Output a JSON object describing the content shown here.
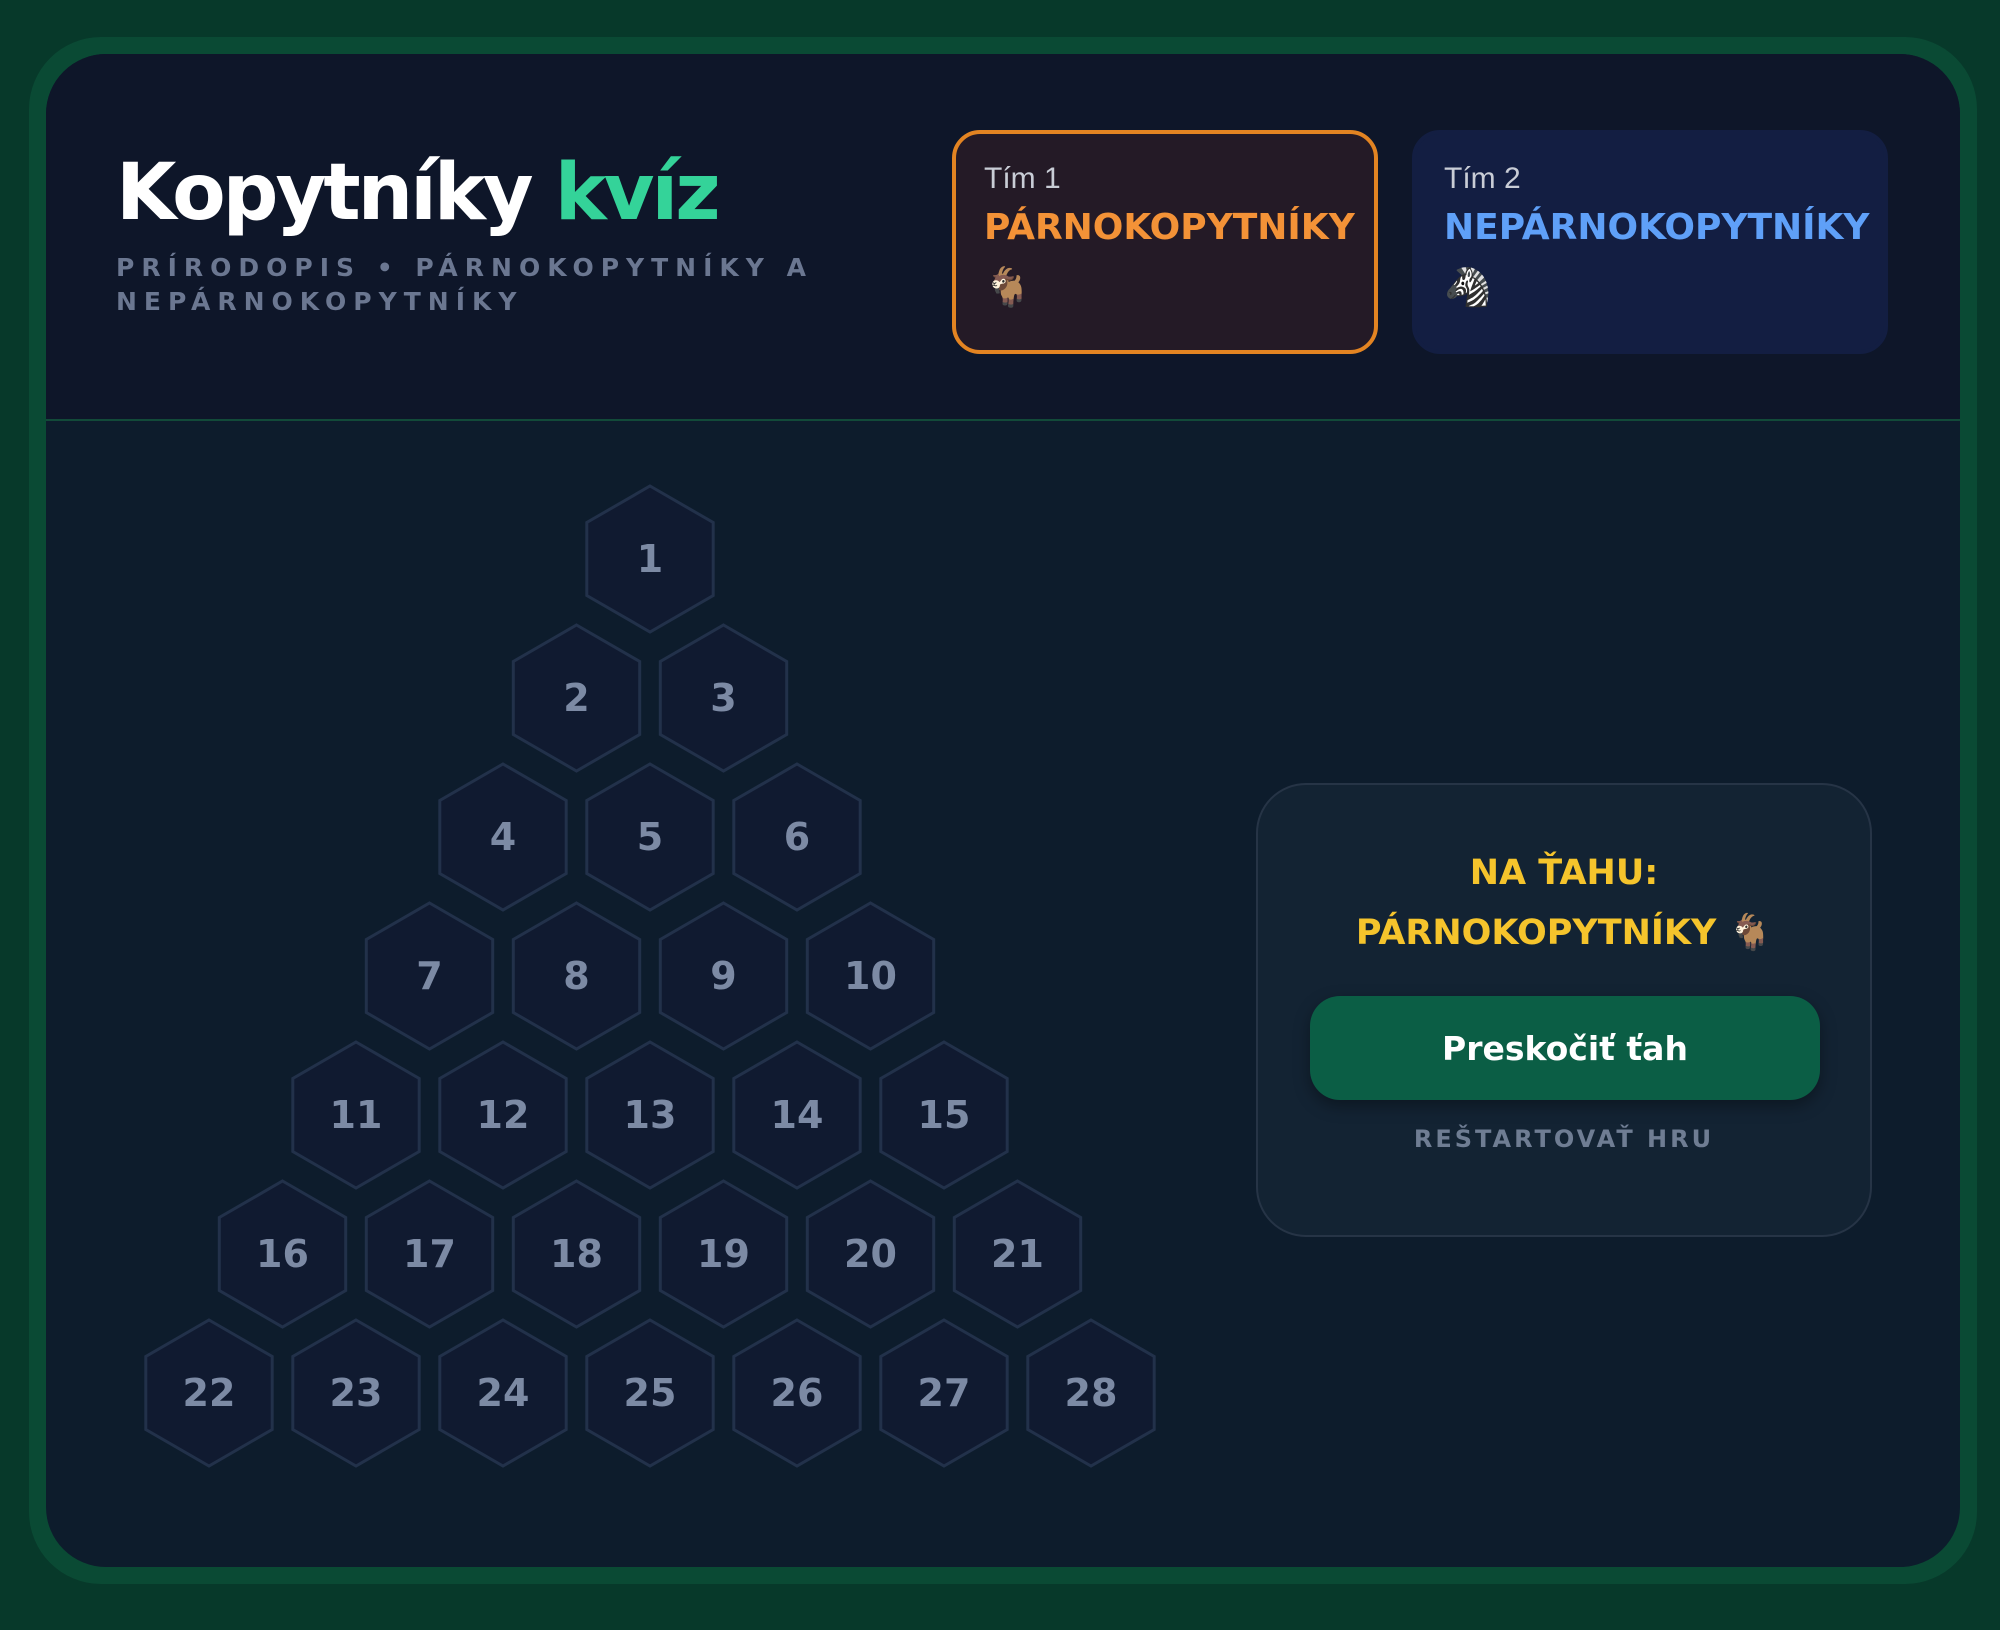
{
  "header": {
    "title_main": "Kopytníky",
    "title_accent": "kvíz",
    "subtitle": "Prírodopis • Párnokopytníky a nepárnokopytníky"
  },
  "teams": [
    {
      "label": "Tím 1",
      "name": "PÁRNOKOPYTNÍKY",
      "icon": "goat-icon",
      "icon_glyph": "🐐",
      "active": true,
      "color": "#f39237"
    },
    {
      "label": "Tím 2",
      "name": "NEPÁRNOKOPYTNÍKY",
      "icon": "zebra-icon",
      "icon_glyph": "🦓",
      "active": false,
      "color": "#5fa0f8"
    }
  ],
  "board": {
    "rows": [
      [
        1
      ],
      [
        2,
        3
      ],
      [
        4,
        5,
        6
      ],
      [
        7,
        8,
        9,
        10
      ],
      [
        11,
        12,
        13,
        14,
        15
      ],
      [
        16,
        17,
        18,
        19,
        20,
        21
      ],
      [
        22,
        23,
        24,
        25,
        26,
        27,
        28
      ]
    ]
  },
  "turn": {
    "line1": "NA ŤAHU:",
    "line2": "PÁRNOKOPYTNÍKY 🐐",
    "skip_label": "Preskočiť ťah",
    "restart_label": "REŠTARTOVAŤ HRU"
  },
  "colors": {
    "accent": "#34d399",
    "team1": "#f39237",
    "team2": "#5fa0f8",
    "turn": "#f5c42c",
    "button": "#0b5e45"
  }
}
